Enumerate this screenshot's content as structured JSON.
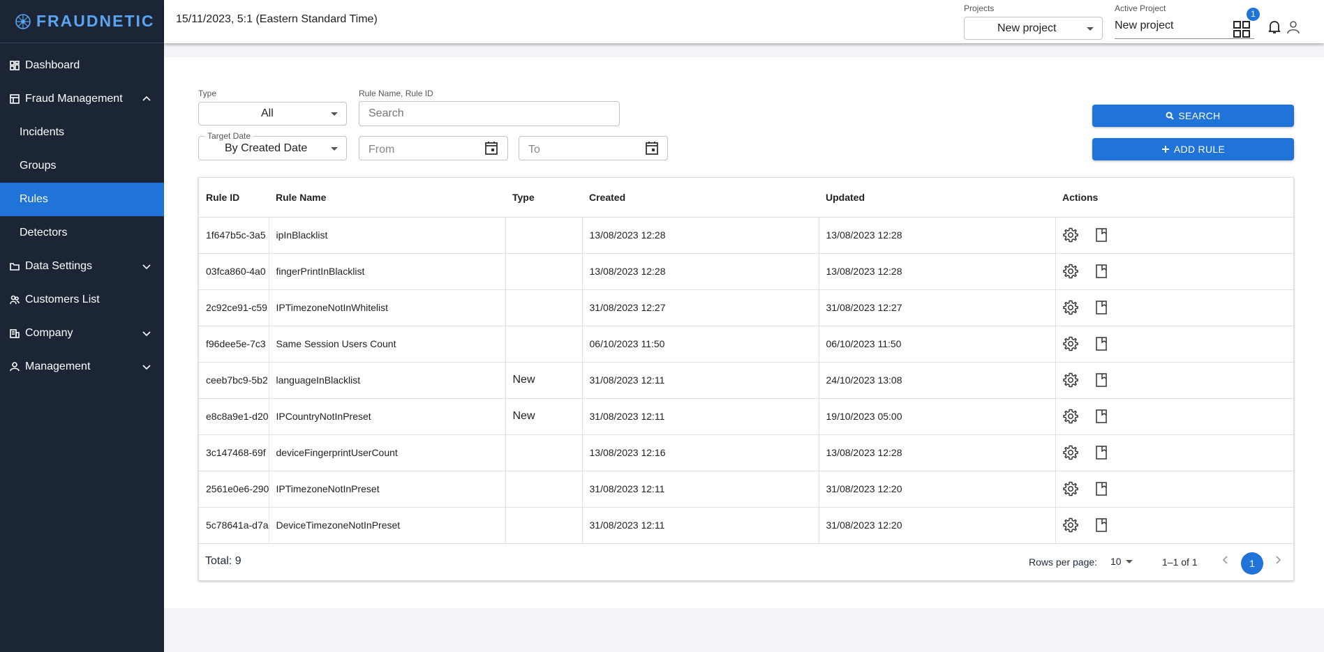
{
  "app": {
    "logo_text": "FRAUDNETIC",
    "accent_color": "#1f73d9",
    "sidebar_color": "#1c2536"
  },
  "header": {
    "datetime": "15/11/2023, 5:1 (Eastern Standard Time)",
    "projects_label": "Projects",
    "projects_value": "New project",
    "active_project_label": "Active Project",
    "active_project_value": "New project",
    "notification_count": "1"
  },
  "sidebar": {
    "dashboard": "Dashboard",
    "fraud_management": "Fraud Management",
    "incidents": "Incidents",
    "groups": "Groups",
    "rules": "Rules",
    "detectors": "Detectors",
    "data_settings": "Data Settings",
    "customers_list": "Customers List",
    "company": "Company",
    "management": "Management"
  },
  "filters": {
    "type_label": "Type",
    "type_value": "All",
    "search_label": "Rule Name, Rule ID",
    "search_placeholder": "Search",
    "target_date_label": "Target Date",
    "target_date_value": "By Created Date",
    "from_placeholder": "From",
    "to_placeholder": "To",
    "search_button": "SEARCH",
    "add_rule_button": "ADD RULE"
  },
  "table": {
    "columns": [
      "Rule ID",
      "Rule Name",
      "Type",
      "Created",
      "Updated",
      "Actions"
    ],
    "rows": [
      {
        "id": "1f647b5c-3a5",
        "name": "ipInBlacklist",
        "type": "",
        "created": "13/08/2023 12:28",
        "updated": "13/08/2023 12:28"
      },
      {
        "id": "03fca860-4a0",
        "name": "fingerPrintInBlacklist",
        "type": "",
        "created": "13/08/2023 12:28",
        "updated": "13/08/2023 12:28"
      },
      {
        "id": "2c92ce91-c59",
        "name": "IPTimezoneNotInWhitelist",
        "type": "",
        "created": "31/08/2023 12:27",
        "updated": "31/08/2023 12:27"
      },
      {
        "id": "f96dee5e-7c3",
        "name": "Same Session Users Count",
        "type": "",
        "created": "06/10/2023 11:50",
        "updated": "06/10/2023 11:50"
      },
      {
        "id": "ceeb7bc9-5b2",
        "name": "languageInBlacklist",
        "type": "New",
        "created": "31/08/2023 12:11",
        "updated": "24/10/2023 13:08"
      },
      {
        "id": "e8c8a9e1-d20",
        "name": "IPCountryNotInPreset",
        "type": "New",
        "created": "31/08/2023 12:11",
        "updated": "19/10/2023 05:00"
      },
      {
        "id": "3c147468-69f",
        "name": "deviceFingerprintUserCount",
        "type": "",
        "created": "13/08/2023 12:16",
        "updated": "13/08/2023 12:28"
      },
      {
        "id": "2561e0e6-290",
        "name": "IPTimezoneNotInPreset",
        "type": "",
        "created": "31/08/2023 12:11",
        "updated": "31/08/2023 12:20"
      },
      {
        "id": "5c78641a-d7a",
        "name": "DeviceTimezoneNotInPreset",
        "type": "",
        "created": "31/08/2023 12:11",
        "updated": "31/08/2023 12:20"
      }
    ],
    "total": "Total: 9",
    "rows_per_page_label": "Rows per page:",
    "rows_per_page_value": "10",
    "range": "1–1 of 1",
    "current_page": "1"
  }
}
